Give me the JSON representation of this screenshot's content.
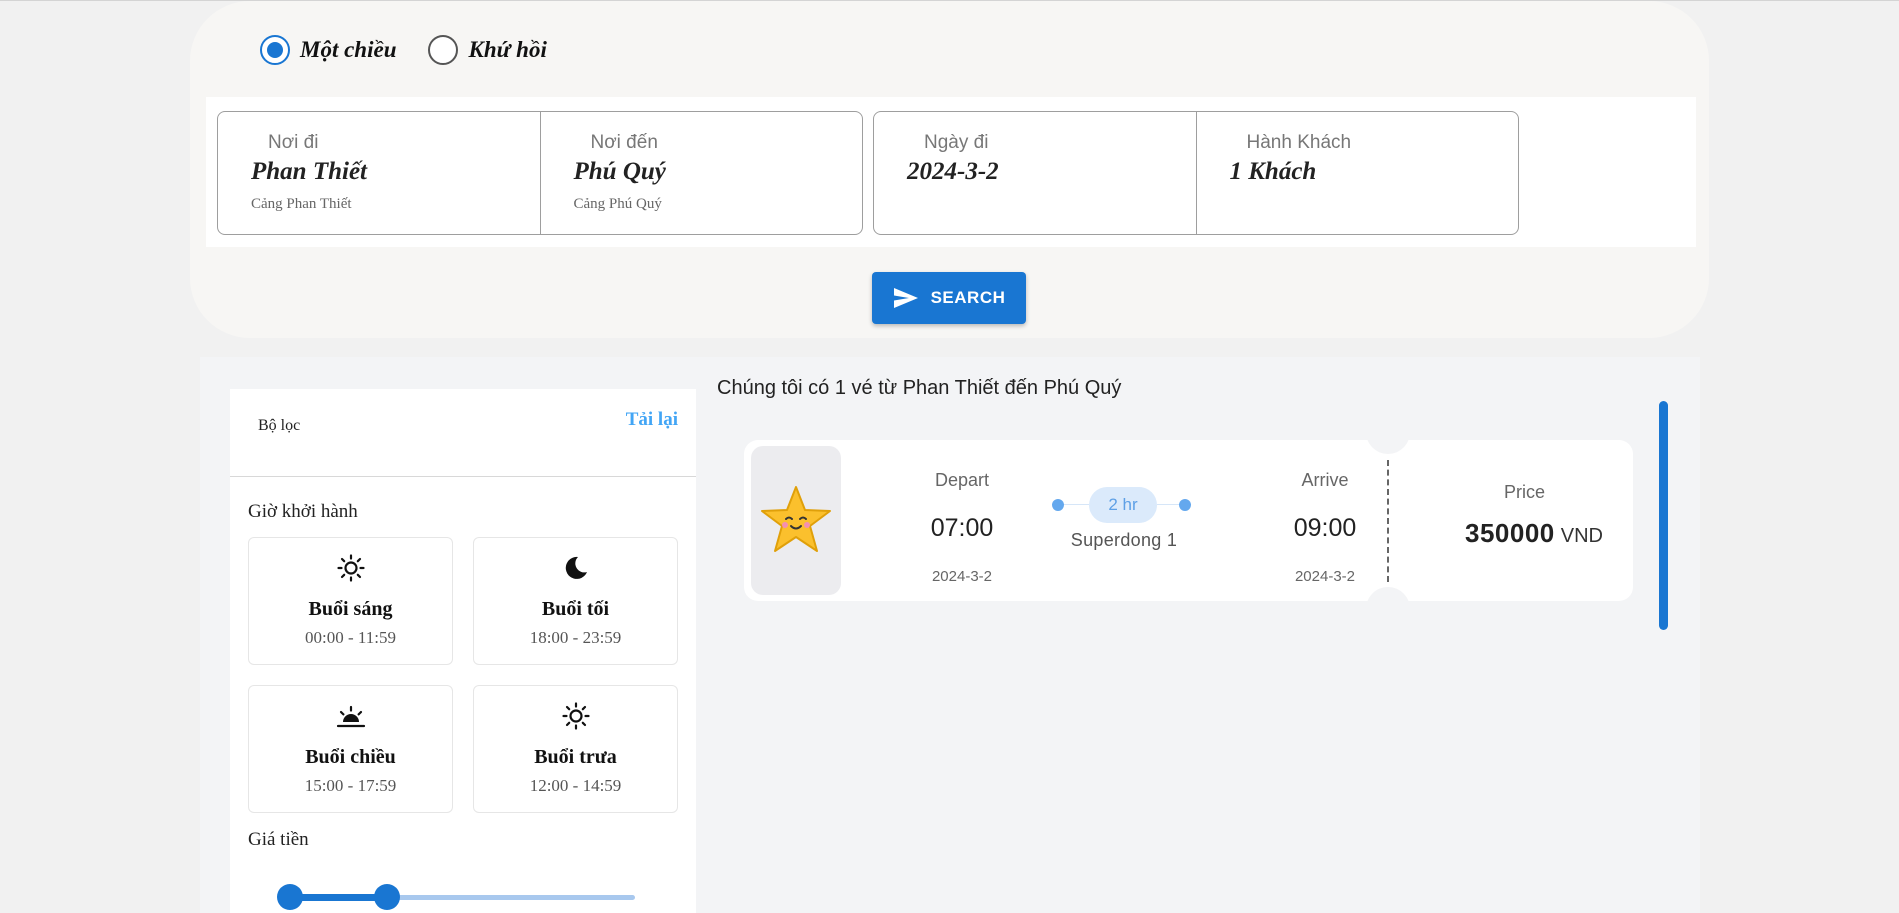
{
  "trip_type": {
    "one_way_label": "Một chiều",
    "round_trip_label": "Khứ hồi",
    "selected": "one_way"
  },
  "search_form": {
    "from": {
      "label": "Nơi đi",
      "value": "Phan Thiết",
      "sub": "Cảng Phan Thiết"
    },
    "to": {
      "label": "Nơi đến",
      "value": "Phú Quý",
      "sub": "Cảng Phú Quý"
    },
    "date": {
      "label": "Ngày đi",
      "value": "2024-3-2"
    },
    "passengers": {
      "label": "Hành Khách",
      "value": "1 Khách"
    },
    "search_button": "SEARCH"
  },
  "filters": {
    "title": "Bộ lọc",
    "reload": "Tải lại",
    "departure_time_title": "Giờ khởi hành",
    "time_slots": [
      {
        "name": "Buổi sáng",
        "range": "00:00 - 11:59",
        "icon": "sun-icon"
      },
      {
        "name": "Buổi tối",
        "range": "18:00 - 23:59",
        "icon": "moon-icon"
      },
      {
        "name": "Buổi chiều",
        "range": "15:00 - 17:59",
        "icon": "sunset-icon"
      },
      {
        "name": "Buổi trưa",
        "range": "12:00 - 14:59",
        "icon": "sun-icon"
      }
    ],
    "price_title": "Giá tiền",
    "price_slider": {
      "low_fraction": 0.0,
      "high_fraction": 0.28
    }
  },
  "results": {
    "heading": "Chúng tôi có 1 vé từ Phan Thiết đến Phú Quý",
    "tickets": [
      {
        "logo_icon": "star-mascot-icon",
        "depart_label": "Depart",
        "depart_time": "07:00",
        "depart_date": "2024-3-2",
        "duration": "2 hr",
        "vessel": "Superdong 1",
        "arrive_label": "Arrive",
        "arrive_time": "09:00",
        "arrive_date": "2024-3-2",
        "price_label": "Price",
        "price_value": "350000",
        "currency": "VND"
      }
    ]
  },
  "colors": {
    "accent": "#1976d2",
    "link": "#42a5f5",
    "duration_pill": "#dbeafb"
  }
}
